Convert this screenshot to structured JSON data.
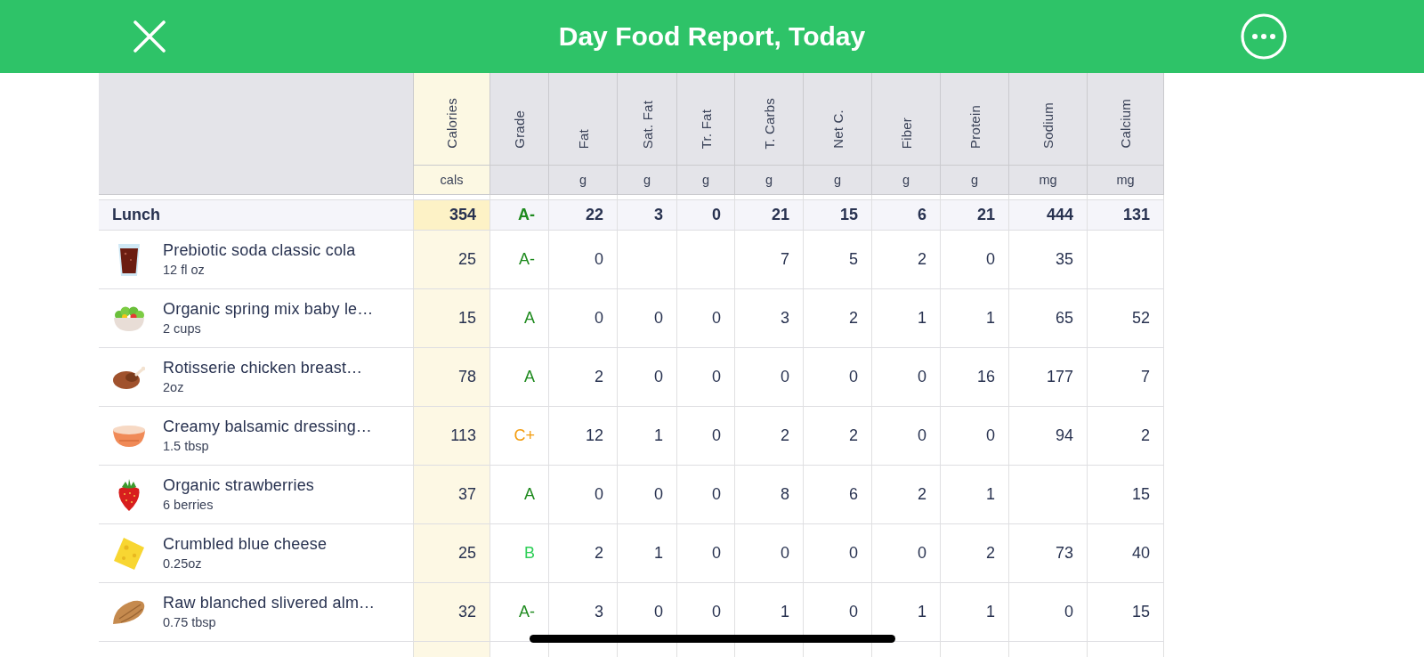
{
  "header": {
    "title": "Day Food Report, Today"
  },
  "table": {
    "columns": [
      {
        "label": "Calories",
        "unit": "cals",
        "kind": "amount",
        "highlighted": true
      },
      {
        "label": "Grade",
        "kind": "grade",
        "highlighted": false
      },
      {
        "label": "Fat",
        "unit": "g",
        "kind": "amount",
        "highlighted": false
      },
      {
        "label": "Sat. Fat",
        "unit": "g",
        "kind": "amount",
        "highlighted": false
      },
      {
        "label": "Tr. Fat",
        "unit": "g",
        "kind": "amount",
        "highlighted": false
      },
      {
        "label": "T. Carbs",
        "unit": "g",
        "kind": "amount",
        "highlighted": false
      },
      {
        "label": "Net C.",
        "unit": "g",
        "kind": "amount",
        "highlighted": false
      },
      {
        "label": "Fiber",
        "unit": "g",
        "kind": "amount",
        "highlighted": false
      },
      {
        "label": "Protein",
        "unit": "g",
        "kind": "amount",
        "highlighted": false
      },
      {
        "label": "Sodium",
        "unit": "mg",
        "kind": "amount",
        "highlighted": false
      },
      {
        "label": "Calcium",
        "unit": "mg",
        "kind": "amount",
        "highlighted": false
      }
    ],
    "meal": {
      "name": "Lunch",
      "cells": [
        "354",
        {
          "text": "A-",
          "color": "#1e8a1e"
        },
        "22",
        "3",
        "0",
        "21",
        "15",
        "6",
        "21",
        "444",
        "131"
      ]
    },
    "rows": [
      {
        "kind": "drink",
        "name": "Prebiotic soda classic cola",
        "serving": "12 fl oz",
        "cells": [
          "25",
          {
            "text": "A-",
            "color": "#1e8a1e"
          },
          "0",
          null,
          null,
          "7",
          "5",
          "2",
          "0",
          "35",
          null
        ]
      },
      {
        "kind": "salad",
        "name": "Organic spring mix baby le…",
        "serving": "2 cups",
        "cells": [
          "15",
          {
            "text": "A",
            "color": "#1e8a1e"
          },
          "0",
          "0",
          "0",
          "3",
          "2",
          "1",
          "1",
          "65",
          "52"
        ]
      },
      {
        "kind": "poultry",
        "name": "Rotisserie chicken breast…",
        "serving": "2oz",
        "cells": [
          "78",
          {
            "text": "A",
            "color": "#1e8a1e"
          },
          "2",
          "0",
          "0",
          "0",
          "0",
          "0",
          "16",
          "177",
          "7"
        ]
      },
      {
        "kind": "dressing",
        "name": "Creamy balsamic dressing…",
        "serving": "1.5 tbsp",
        "cells": [
          "113",
          {
            "text": "C+",
            "color": "#f39c0e"
          },
          "12",
          "1",
          "0",
          "2",
          "2",
          "0",
          "0",
          "94",
          "2"
        ]
      },
      {
        "kind": "fruit",
        "name": "Organic strawberries",
        "serving": "6 berries",
        "cells": [
          "37",
          {
            "text": "A",
            "color": "#1e8a1e"
          },
          "0",
          "0",
          "0",
          "8",
          "6",
          "2",
          "1",
          null,
          "15"
        ]
      },
      {
        "kind": "cheese",
        "name": "Crumbled blue cheese",
        "serving": "0.25oz",
        "cells": [
          "25",
          {
            "text": "B",
            "color": "#2fcf58"
          },
          "2",
          "1",
          "0",
          "0",
          "0",
          "0",
          "2",
          "73",
          "40"
        ]
      },
      {
        "kind": "nut",
        "name": "Raw blanched slivered alm…",
        "serving": "0.75 tbsp",
        "cells": [
          "32",
          {
            "text": "A-",
            "color": "#1e8a1e"
          },
          "3",
          "0",
          "0",
          "1",
          "0",
          "1",
          "1",
          "0",
          "15"
        ]
      }
    ]
  }
}
